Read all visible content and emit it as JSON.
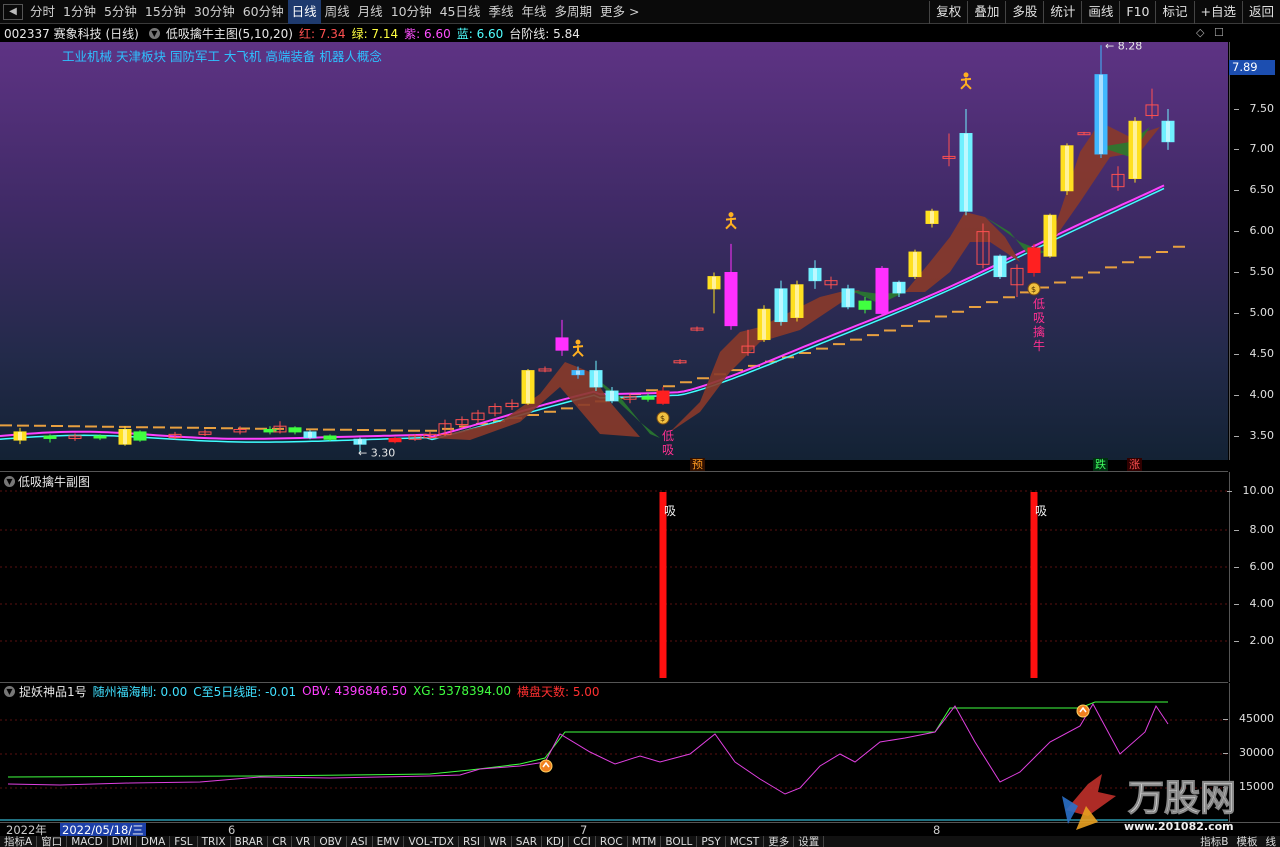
{
  "toolbar": {
    "back_icon": "back-arrow-icon",
    "periods": [
      "分时",
      "1分钟",
      "5分钟",
      "15分钟",
      "30分钟",
      "60分钟",
      "日线",
      "周线",
      "月线",
      "10分钟",
      "45日线",
      "季线",
      "年线",
      "多周期",
      "更多 >"
    ],
    "active_period": "日线",
    "tools": [
      "复权",
      "叠加",
      "多股",
      "统计",
      "画线",
      "F10",
      "标记",
      "+自选",
      "返回"
    ]
  },
  "info": {
    "stock": "002337 赛象科技 (日线)",
    "indicator": "低吸擒牛主图(5,10,20)",
    "red_label": "红: 7.34",
    "green_label": "绿: 7.14",
    "purple_label": "紫: 6.60",
    "blue_label": "蓝: 6.60",
    "step_label": "台阶线: 5.84",
    "colors": {
      "red": "#ff4040",
      "green": "#ffff00",
      "purple": "#ff40ff",
      "blue": "#40ffff"
    }
  },
  "sectors": "工业机械 天津板块 国防军工 大飞机 高端装备 机器人概念",
  "main_chart": {
    "price_axis": [
      "7.50",
      "7.00",
      "6.50",
      "6.00",
      "5.50",
      "5.00",
      "4.50",
      "4.00",
      "3.50"
    ],
    "current_price": "7.89",
    "high_label": "8.28",
    "low_label": "3.30",
    "low_buy_text_1": "低吸",
    "low_buy_text_2": "低吸擒牛",
    "signal_tags": {
      "yu": "预",
      "die": "跌",
      "zhang": "涨"
    }
  },
  "sub1": {
    "title": "低吸擒牛副图",
    "axis": [
      "10.00",
      "8.00",
      "6.00",
      "4.00",
      "2.00"
    ],
    "bar_label": "吸",
    "bars": [
      10,
      10
    ]
  },
  "sub2": {
    "title": "捉妖神品1号",
    "v1": "随州福海制: 0.00",
    "v2": "C至5日线距: -0.01",
    "v3": "OBV: 4396846.50",
    "v4": "XG: 5378394.00",
    "v5": "横盘天数: 5.00",
    "axis": [
      "45000",
      "30000",
      "15000"
    ],
    "colors": {
      "v1": "#40e0ff",
      "v2": "#40e0ff",
      "v3": "#ff40ff",
      "v4": "#40ff40",
      "v5": "#ff3030"
    }
  },
  "timeaxis": {
    "year": "2022年",
    "cursor_date": "2022/05/18/三",
    "months": [
      "6",
      "7",
      "8"
    ]
  },
  "tabs": [
    "指标A",
    "窗口",
    "MACD",
    "DMI",
    "DMA",
    "FSL",
    "TRIX",
    "BRAR",
    "CR",
    "VR",
    "OBV",
    "ASI",
    "EMV",
    "VOL-TDX",
    "RSI",
    "WR",
    "SAR",
    "KDJ",
    "CCI",
    "ROC",
    "MTM",
    "BOLL",
    "PSY",
    "MCST",
    "更多",
    "设置"
  ],
  "tabs_right": [
    "指标B",
    "模板",
    "线"
  ],
  "watermark": {
    "brand": "万股网",
    "url": "www.201082.com"
  }
}
